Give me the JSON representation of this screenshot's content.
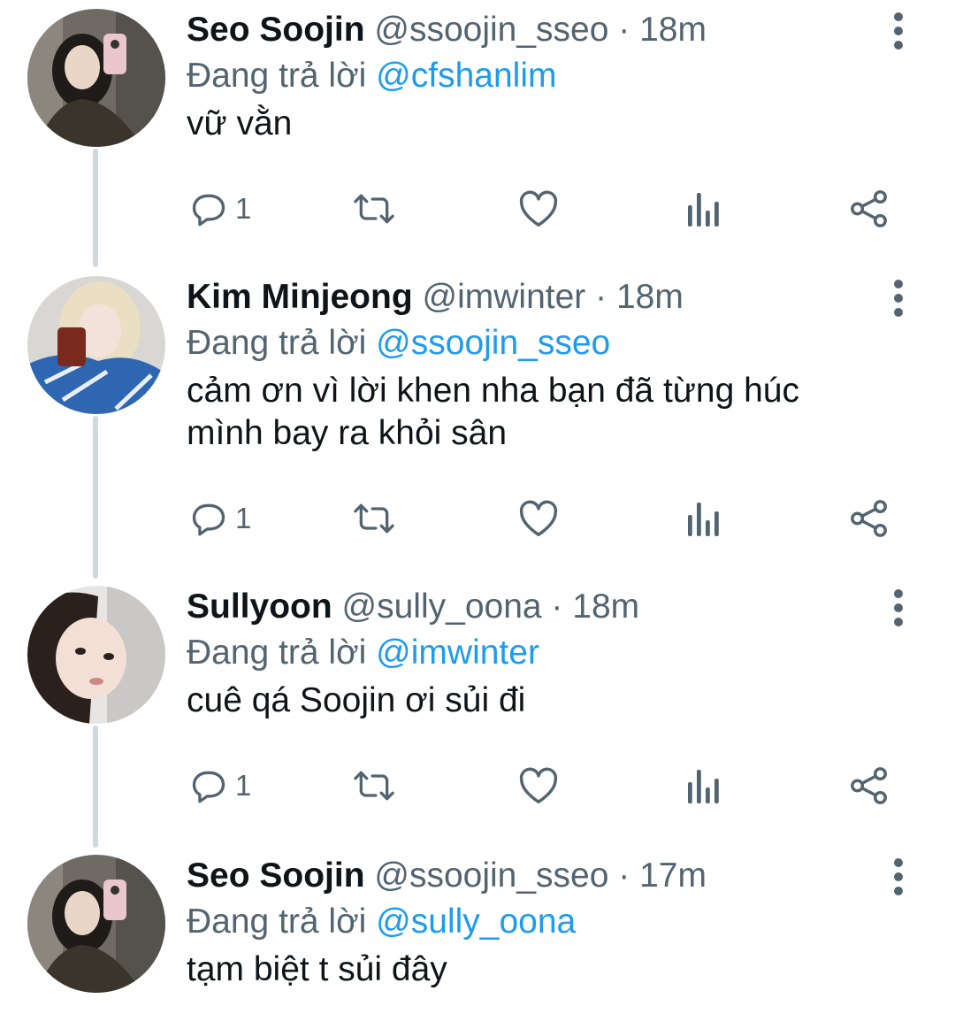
{
  "reply_prefix": "Đang trả lời",
  "tweets": [
    {
      "name": "Seo Soojin",
      "handle": "@ssoojin_sseo",
      "separator": "·",
      "time": "18m",
      "reply_to": "@cfshanlim",
      "text": "vữ vằn",
      "reply_count": "1",
      "avatar": "avatar-seo-soojin"
    },
    {
      "name": "Kim Minjeong",
      "handle": "@imwinter",
      "separator": "·",
      "time": "18m",
      "reply_to": "@ssoojin_sseo",
      "text": "cảm ơn vì lời khen nha bạn đã từng húc mình bay ra khỏi sân",
      "reply_count": "1",
      "avatar": "avatar-kim-minjeong"
    },
    {
      "name": "Sullyoon",
      "handle": "@sully_oona",
      "separator": "·",
      "time": "18m",
      "reply_to": "@imwinter",
      "text": "cuê qá Soojin ơi sủi đi",
      "reply_count": "1",
      "avatar": "avatar-sullyoon"
    },
    {
      "name": "Seo Soojin",
      "handle": "@ssoojin_sseo",
      "separator": "·",
      "time": "17m",
      "reply_to": "@sully_oona",
      "text": "tạm biệt t sủi đây",
      "avatar": "avatar-seo-soojin"
    }
  ],
  "icons": [
    "reply-icon",
    "retweet-icon",
    "like-icon",
    "views-icon",
    "share-icon",
    "more-icon"
  ],
  "colors": {
    "accent": "#1d9bf0",
    "secondary_text": "#536471",
    "thread_line": "#cfd9de"
  }
}
